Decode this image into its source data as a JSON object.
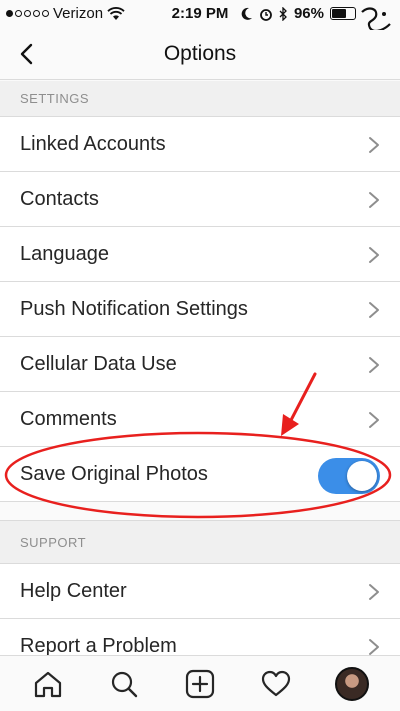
{
  "status_bar": {
    "carrier": "Verizon",
    "time": "2:19 PM",
    "battery": "96%"
  },
  "nav": {
    "title": "Options"
  },
  "sections": {
    "settings": "SETTINGS",
    "support": "SUPPORT"
  },
  "settings_items": [
    {
      "label": "Linked Accounts"
    },
    {
      "label": "Contacts"
    },
    {
      "label": "Language"
    },
    {
      "label": "Push Notification Settings"
    },
    {
      "label": "Cellular Data Use"
    },
    {
      "label": "Comments"
    },
    {
      "label": "Save Original Photos",
      "toggle_on": true
    }
  ],
  "support_items": [
    {
      "label": "Help Center"
    },
    {
      "label": "Report a Problem"
    }
  ],
  "colors": {
    "toggle_on": "#3b8ee8",
    "annotation": "#e8201e"
  },
  "icons": {
    "back": "chevron-left-icon",
    "row": "chevron-right-icon",
    "tabs": [
      "home-icon",
      "search-icon",
      "add-icon",
      "heart-icon",
      "profile-avatar"
    ]
  }
}
